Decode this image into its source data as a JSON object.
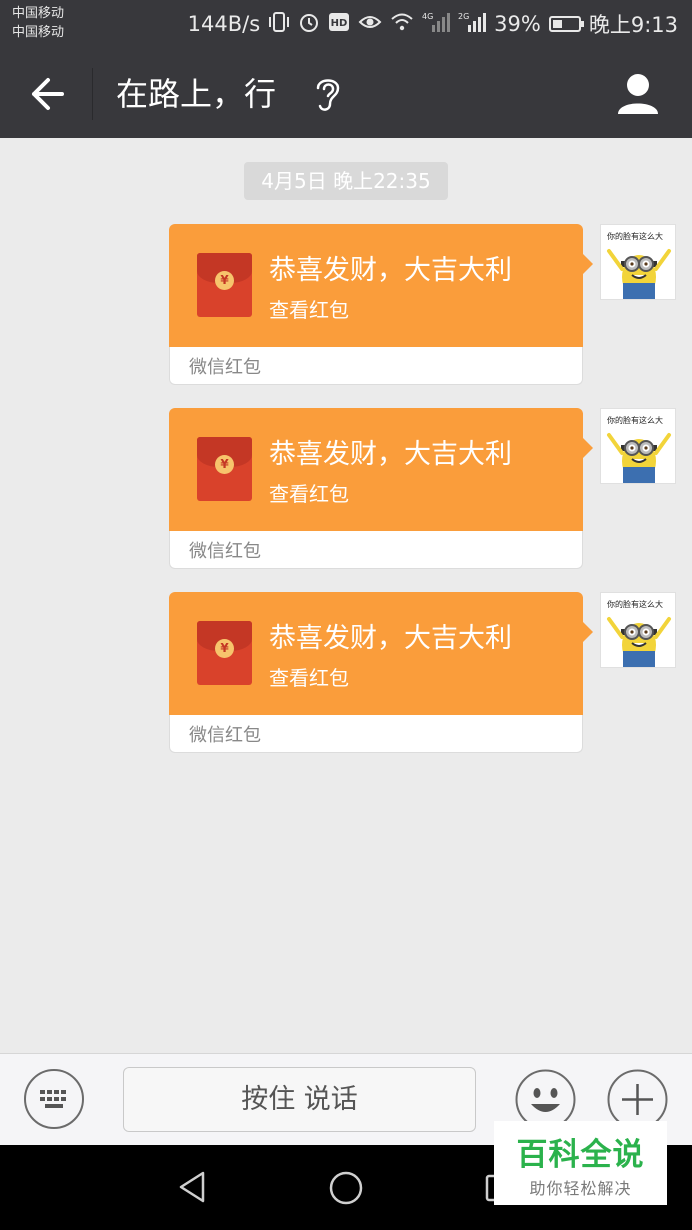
{
  "status_bar": {
    "carrier_1": "中国移动",
    "carrier_2": "中国移动",
    "net_speed": "144B/s",
    "signal_4g": "4G",
    "signal_2g": "2G",
    "battery": "39%",
    "battery_level": 0.39,
    "time": "晚上9:13"
  },
  "header": {
    "title": "在路上，行"
  },
  "chat": {
    "timestamp": "4月5日 晚上22:35",
    "messages": [
      {
        "title": "恭喜发财，大吉大利",
        "subtitle": "查看红包",
        "footer": "微信红包",
        "coin": "¥"
      },
      {
        "title": "恭喜发财，大吉大利",
        "subtitle": "查看红包",
        "footer": "微信红包",
        "coin": "¥"
      },
      {
        "title": "恭喜发财，大吉大利",
        "subtitle": "查看红包",
        "footer": "微信红包",
        "coin": "¥"
      }
    ],
    "avatar_caption": "你的脸有这么大"
  },
  "input_bar": {
    "talk_label": "按住 说话"
  },
  "watermark": {
    "title": "百科全说",
    "subtitle": "助你轻松解决"
  },
  "colors": {
    "header_bg": "#38383c",
    "packet_orange": "#fa9d3b",
    "envelope_red": "#d9422b",
    "watermark_green": "#2bb24c"
  }
}
